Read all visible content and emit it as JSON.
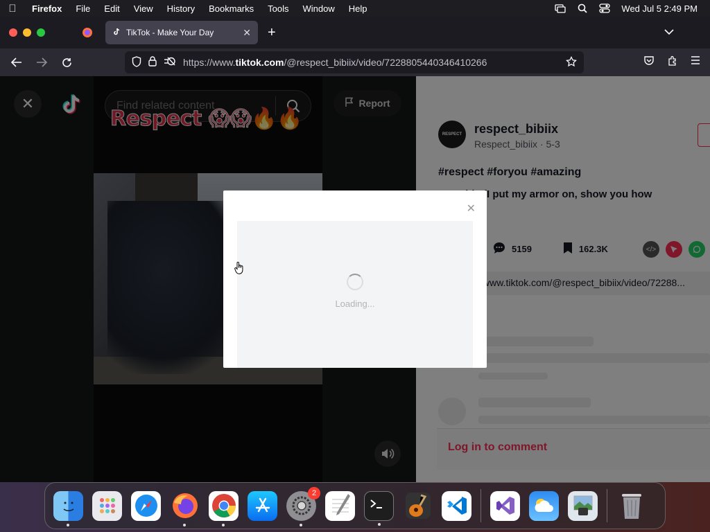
{
  "menubar": {
    "app": "Firefox",
    "items": [
      "File",
      "Edit",
      "View",
      "History",
      "Bookmarks",
      "Tools",
      "Window",
      "Help"
    ],
    "datetime": "Wed Jul 5  2:49 PM"
  },
  "browser": {
    "tab_title": "TikTok - Make Your Day",
    "url_prefix": "https://www.",
    "url_domain": "tiktok.com",
    "url_path": "/@respect_bibiix/video/7228805440346410266"
  },
  "video": {
    "search_placeholder": "Find related content",
    "caption_overlay": "Respect 😱😱🔥🔥",
    "report_label": "Report"
  },
  "post": {
    "username": "respect_bibiix",
    "subline": "Respect_bibiix · 5-3",
    "avatar_text": "RESPECT",
    "hashtags": "#respect #foryou #amazing",
    "description": "...ppable (I put my armor on, show you how",
    "comments_count": "5159",
    "saves_count": "162.3K",
    "link_text": "www.tiktok.com/@respect_bibiix/video/72288...",
    "login_comment": "Log in to comment"
  },
  "modal": {
    "loading_text": "Loading..."
  },
  "dock": {
    "items": [
      "Finder",
      "Launchpad",
      "Safari",
      "Firefox",
      "Chrome",
      "App Store",
      "System Settings",
      "TextEdit",
      "Terminal",
      "GarageBand",
      "VS Code",
      "Visual Studio",
      "Weather",
      "Preview",
      "Trash"
    ],
    "settings_badge": "2"
  }
}
